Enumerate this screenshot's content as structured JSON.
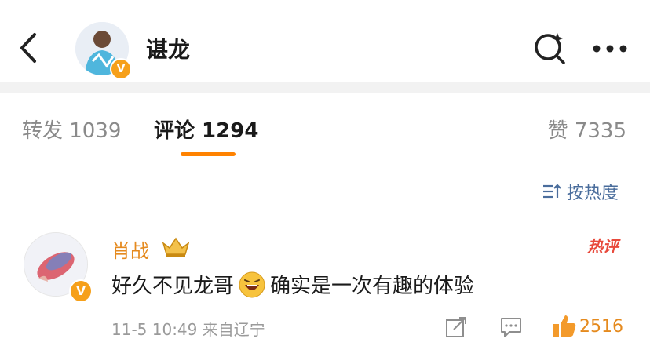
{
  "header": {
    "title": "谌龙",
    "avatar_badge": "V",
    "icons": [
      "back-icon",
      "search-icon",
      "more-icon"
    ]
  },
  "tabs": [
    {
      "label": "转发 1039"
    },
    {
      "label": "评论 1294"
    },
    {
      "label": "赞 7335"
    }
  ],
  "sort": {
    "label": "按热度",
    "icon": "sort-icon"
  },
  "comment": {
    "author": "肖战",
    "hot_label": "热评",
    "avatar_badge": "V",
    "text_before": "好久不见龙哥",
    "text_after": "确实是一次有趣的体验",
    "meta": "11-5 10:49  来自辽宁",
    "likes": "2516"
  },
  "colors": {
    "accent": "#ff8200",
    "name": "#e58a1e",
    "hot": "#e8493b",
    "link": "#4a6d9c"
  }
}
